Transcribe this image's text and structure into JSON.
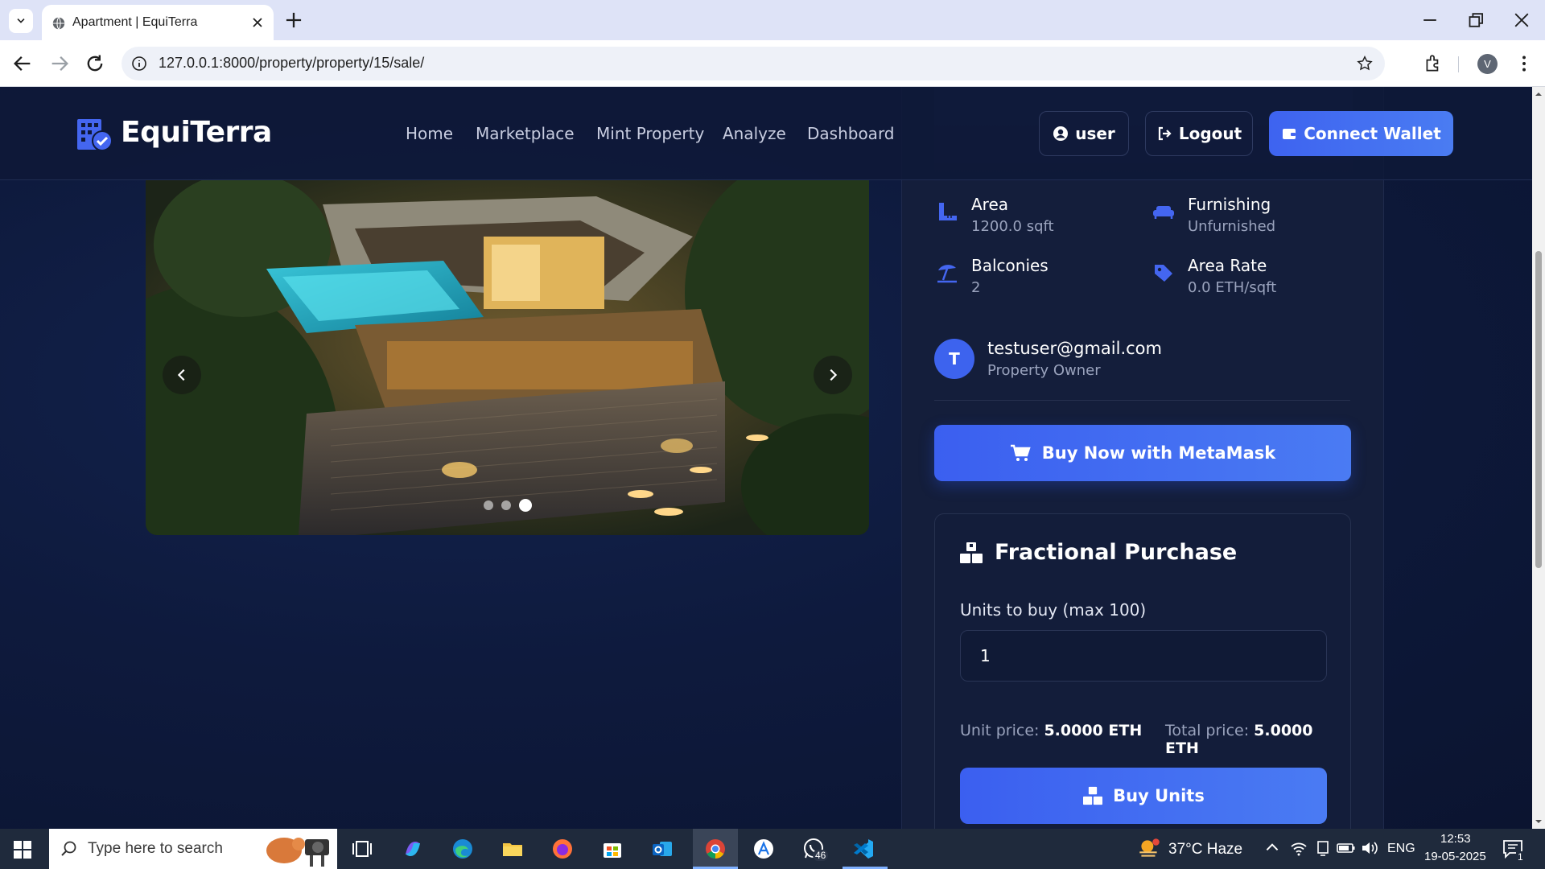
{
  "browser": {
    "tab_title": "Apartment | EquiTerra",
    "url": "127.0.0.1:8000/property/property/15/sale/",
    "profile_initial": "V"
  },
  "site": {
    "brand": "EquiTerra",
    "nav": [
      "Home",
      "Marketplace",
      "Mint Property",
      "Analyze",
      "Dashboard"
    ],
    "user_button": "user",
    "logout_button": "Logout",
    "connect_button": "Connect Wallet"
  },
  "carousel": {
    "slide_count": 3,
    "active_slide": 3
  },
  "features": [
    {
      "icon": "ruler-icon",
      "label": "Area",
      "value": "1200.0 sqft"
    },
    {
      "icon": "couch-icon",
      "label": "Furnishing",
      "value": "Unfurnished"
    },
    {
      "icon": "umbrella-beach-icon",
      "label": "Balconies",
      "value": "2"
    },
    {
      "icon": "tag-icon",
      "label": "Area Rate",
      "value": "0.0 ETH/sqft"
    }
  ],
  "owner": {
    "initial": "T",
    "email": "testuser@gmail.com",
    "role": "Property Owner"
  },
  "buy_now_label": "Buy Now with MetaMask",
  "fractional": {
    "title": "Fractional Purchase",
    "units_label": "Units to buy (max 100)",
    "units_value": "1",
    "unit_price_label": "Unit price:",
    "unit_price": "5.0000 ETH",
    "total_price_label": "Total price:",
    "total_price": "5.0000 ETH",
    "buy_units_label": "Buy Units"
  },
  "taskbar": {
    "search_placeholder": "Type here to search",
    "weather": "37°C  Haze",
    "language": "ENG",
    "time": "12:53",
    "date": "19-05-2025",
    "whatsapp_badge": "46",
    "notification_count": "1"
  },
  "colors": {
    "accent": "#3d63ee",
    "page_bg": "#0f1733",
    "card_bg": "#141e3b"
  }
}
